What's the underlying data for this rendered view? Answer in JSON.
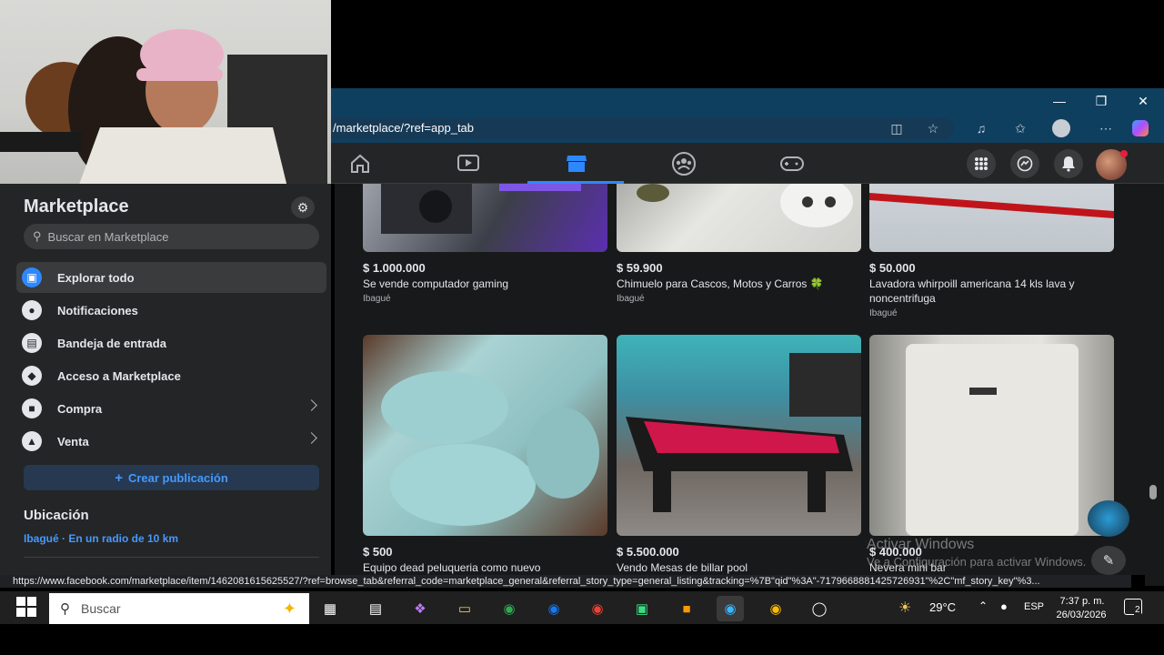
{
  "browser": {
    "url": "/marketplace/?ref=app_tab",
    "status_url": "https://www.facebook.com/marketplace/item/1462081615625527/?ref=browse_tab&referral_code=marketplace_general&referral_story_type=general_listing&tracking=%7B\"qid\"%3A\"-7179668881425726931\"%2C\"mf_story_key\"%3..."
  },
  "sidebar": {
    "title": "Marketplace",
    "search_placeholder": "Buscar en Marketplace",
    "items": [
      {
        "label": "Explorar todo",
        "icon": "store-icon"
      },
      {
        "label": "Notificaciones",
        "icon": "bell-icon"
      },
      {
        "label": "Bandeja de entrada",
        "icon": "inbox-icon"
      },
      {
        "label": "Acceso a Marketplace",
        "icon": "shield-icon"
      },
      {
        "label": "Compra",
        "icon": "bag-icon"
      },
      {
        "label": "Venta",
        "icon": "tag-icon"
      }
    ],
    "create_button": "Crear publicación",
    "location_heading": "Ubicación",
    "location_value": "Ibagué · En un radio de 10 km"
  },
  "listings": [
    {
      "price": "$ 1.000.000",
      "title": "Se vende computador gaming",
      "location": "Ibagué"
    },
    {
      "price": "$ 59.900",
      "title": "Chimuelo para Cascos, Motos y Carros 🍀",
      "location": "Ibagué"
    },
    {
      "price": "$ 50.000",
      "title": "Lavadora whirpoill americana 14 kls lava y noncentrifuga",
      "location": "Ibagué"
    },
    {
      "price": "$ 500",
      "title": "Equipo dead peluqueria como nuevo",
      "location": ""
    },
    {
      "price": "$ 5.500.000",
      "title": "Vendo Mesas de billar pool",
      "location": ""
    },
    {
      "price": "$ 400.000",
      "title": "Nevera mini bar",
      "location": ""
    }
  ],
  "watermark": {
    "line1": "Activar Windows",
    "line2": "Ve a Configuración para activar Windows."
  },
  "taskbar": {
    "search_placeholder": "Buscar",
    "weather": "29°C",
    "language": "ESP",
    "time": "7:37 p. m.",
    "date": "26/03/2026",
    "notifications_badge": "2"
  },
  "colors": {
    "fb_blue": "#2d88ff",
    "dark_bg": "#18191a",
    "surface": "#242526"
  }
}
